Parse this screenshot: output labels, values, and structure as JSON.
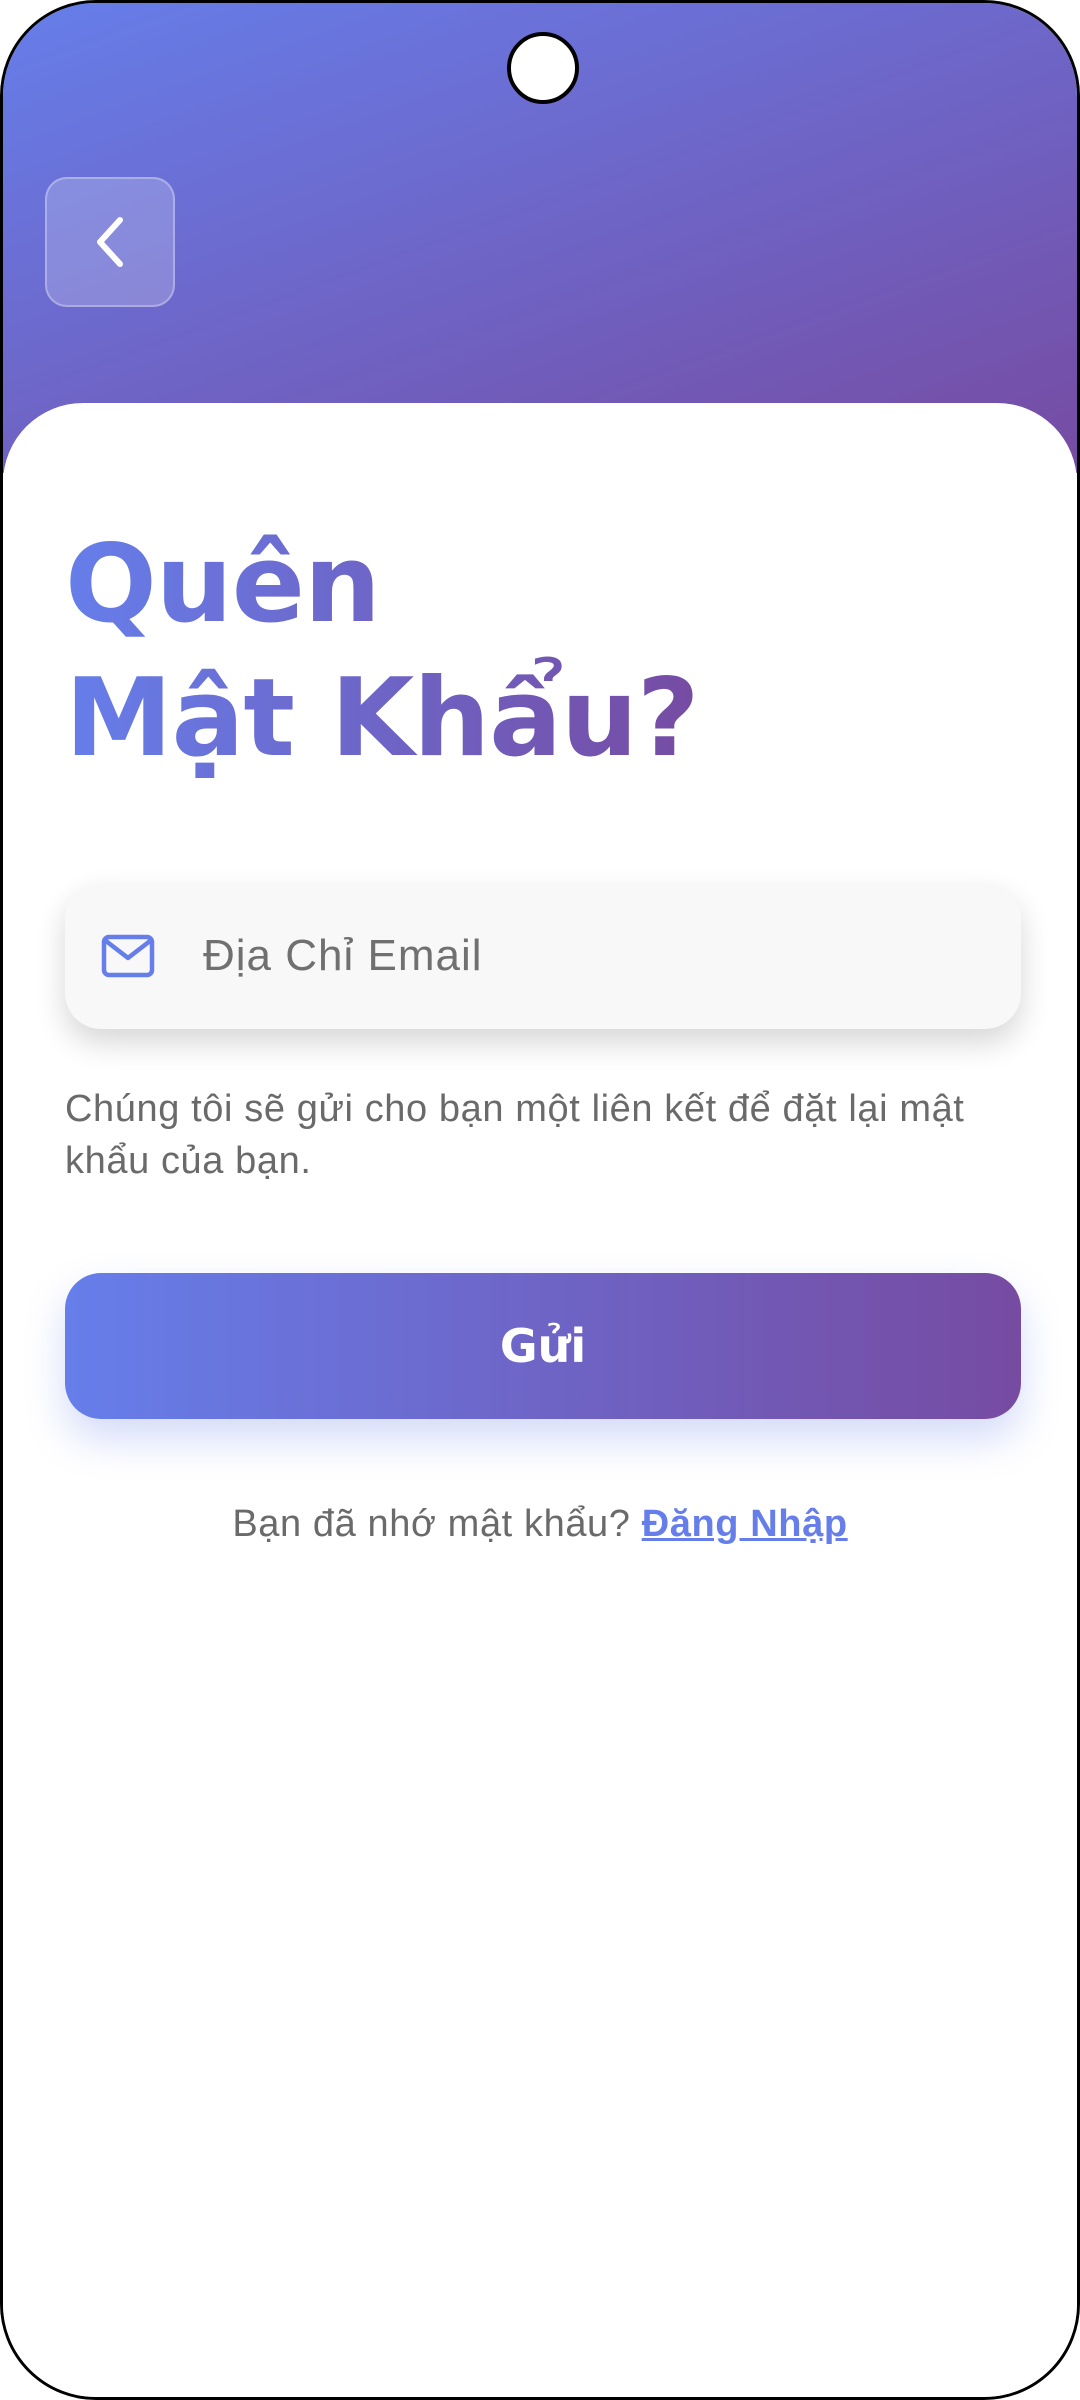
{
  "header": {
    "back_icon": "chevron-left-icon"
  },
  "title": {
    "line1": "Quên",
    "line2": "Mật Khẩu?"
  },
  "email": {
    "placeholder": "Địa Chỉ Email",
    "value": "",
    "icon": "mail-icon"
  },
  "helper_text": "Chúng tôi sẽ gửi cho bạn một liên kết để đặt lại mật khẩu của bạn.",
  "send_button": {
    "label": "Gửi"
  },
  "remember": {
    "prompt": "Bạn đã nhớ mật khẩu?",
    "link_label": "Đăng Nhập"
  },
  "colors": {
    "gradient_start": "#667eea",
    "gradient_end": "#764ba2",
    "text_muted": "#6a6a6a",
    "input_bg": "#f8f8f8"
  }
}
